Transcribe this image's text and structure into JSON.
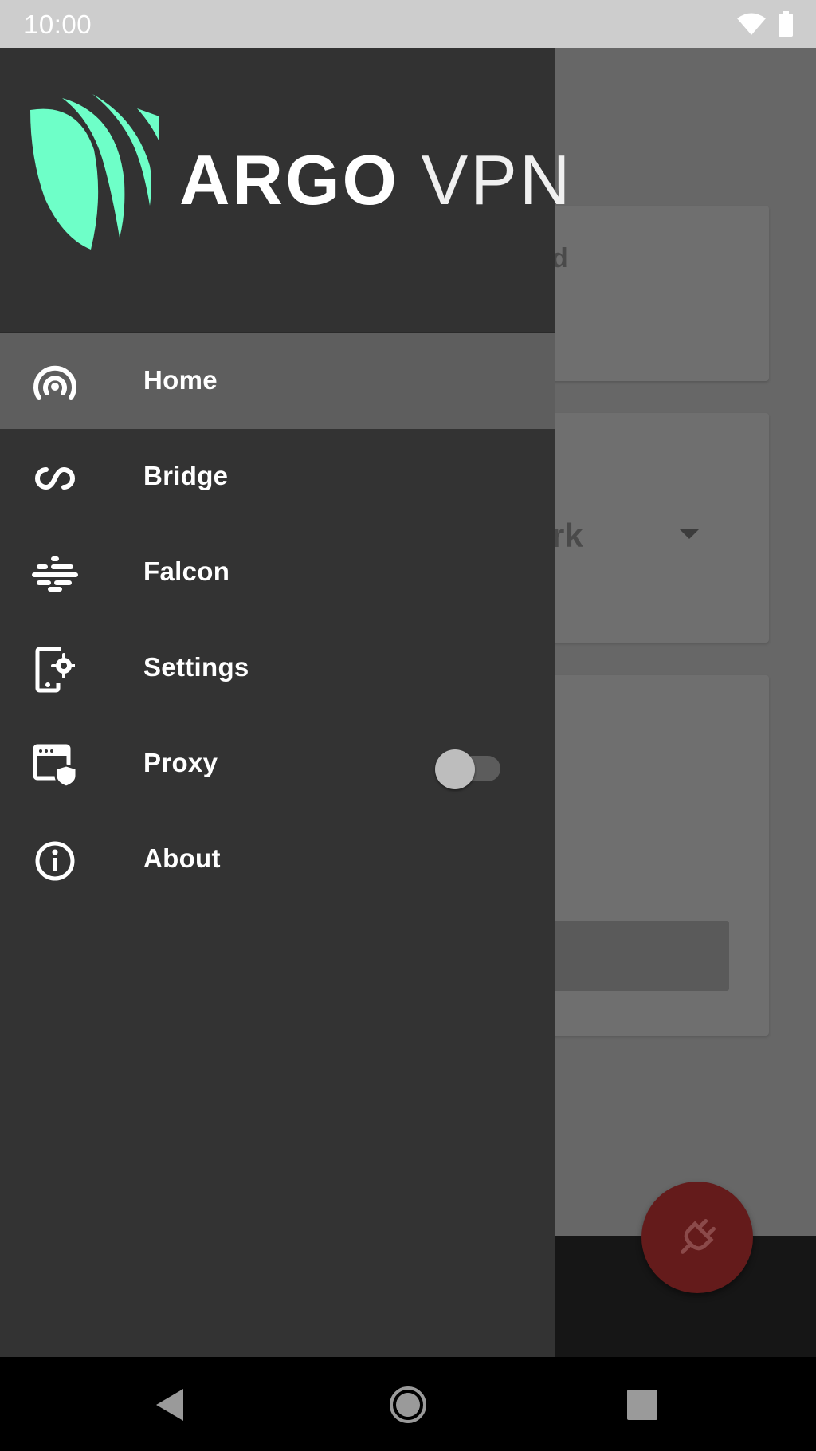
{
  "status_bar": {
    "time": "10:00",
    "icons": [
      "wifi-icon",
      "battery-icon"
    ]
  },
  "background": {
    "card1_fragment": "d",
    "card2_fragment": "rk"
  },
  "drawer": {
    "logo": {
      "brand_bold": "ARGO",
      "brand_light": "VPN",
      "accent_color": "#6effc8"
    },
    "items": [
      {
        "label": "Home",
        "icon": "home-signal-icon",
        "active": true
      },
      {
        "label": "Bridge",
        "icon": "infinity-link-icon",
        "active": false
      },
      {
        "label": "Falcon",
        "icon": "falcon-icon",
        "active": false
      },
      {
        "label": "Settings",
        "icon": "phone-settings-icon",
        "active": false
      },
      {
        "label": "Proxy",
        "icon": "browser-shield-icon",
        "active": false,
        "toggle": "off"
      },
      {
        "label": "About",
        "icon": "info-icon",
        "active": false
      }
    ]
  },
  "fab": {
    "icon": "plug-icon",
    "color": "#641b1b"
  },
  "nav_bar": {
    "buttons": [
      "back-icon",
      "home-icon",
      "recents-icon"
    ]
  }
}
